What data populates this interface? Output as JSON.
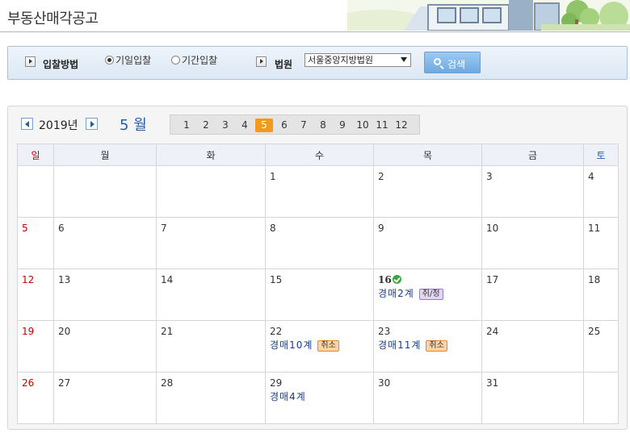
{
  "page": {
    "title": "부동산매각공고"
  },
  "search": {
    "bid_method_label": "입찰방법",
    "options": [
      {
        "label": "기일입찰",
        "checked": true
      },
      {
        "label": "기간입찰",
        "checked": false
      }
    ],
    "court_label": "법원",
    "court_value": "서울중앙지방법원",
    "search_button": "검색"
  },
  "calendar": {
    "year": "2019년",
    "month_num": "5",
    "month_unit": "월",
    "months": [
      "1",
      "2",
      "3",
      "4",
      "5",
      "6",
      "7",
      "8",
      "9",
      "10",
      "11",
      "12"
    ],
    "selected_month": "5",
    "weekdays": [
      "일",
      "월",
      "화",
      "수",
      "목",
      "금",
      "토"
    ],
    "weeks": [
      [
        {
          "day": ""
        },
        {
          "day": ""
        },
        {
          "day": ""
        },
        {
          "day": "1"
        },
        {
          "day": "2"
        },
        {
          "day": "3"
        },
        {
          "day": "4"
        }
      ],
      [
        {
          "day": "5"
        },
        {
          "day": "6"
        },
        {
          "day": "7"
        },
        {
          "day": "8"
        },
        {
          "day": "9"
        },
        {
          "day": "10"
        },
        {
          "day": "11"
        }
      ],
      [
        {
          "day": "12"
        },
        {
          "day": "13"
        },
        {
          "day": "14"
        },
        {
          "day": "15"
        },
        {
          "day": "16",
          "today": true,
          "events": [
            {
              "text": "경매2계",
              "badge": "취/정",
              "badge_type": "change"
            }
          ]
        },
        {
          "day": "17"
        },
        {
          "day": "18"
        }
      ],
      [
        {
          "day": "19"
        },
        {
          "day": "20"
        },
        {
          "day": "21"
        },
        {
          "day": "22",
          "events": [
            {
              "text": "경매10계",
              "badge": "취소",
              "badge_type": "cancel"
            }
          ]
        },
        {
          "day": "23",
          "events": [
            {
              "text": "경매11계",
              "badge": "취소",
              "badge_type": "cancel"
            }
          ]
        },
        {
          "day": "24"
        },
        {
          "day": "25"
        }
      ],
      [
        {
          "day": "26"
        },
        {
          "day": "27"
        },
        {
          "day": "28"
        },
        {
          "day": "29",
          "events": [
            {
              "text": "경매4계"
            }
          ]
        },
        {
          "day": "30"
        },
        {
          "day": "31"
        },
        {
          "day": ""
        }
      ]
    ]
  }
}
